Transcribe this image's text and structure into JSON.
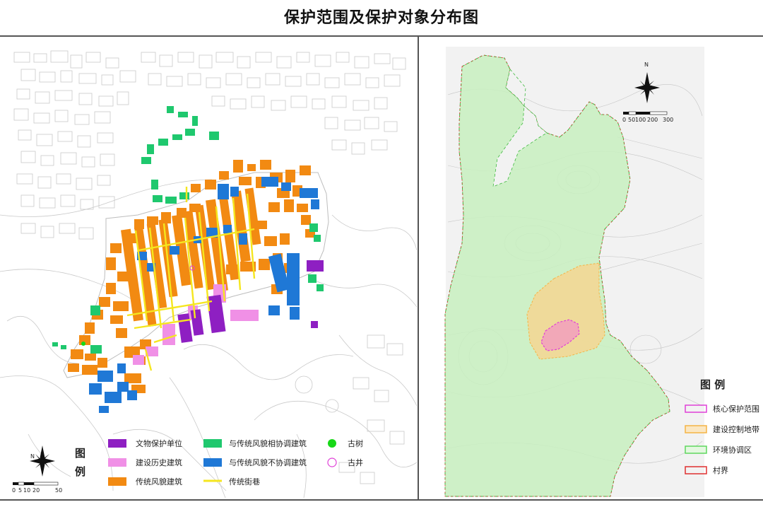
{
  "title": "保护范围及保护对象分布图",
  "left_map": {
    "legend_title_1": "图",
    "legend_title_2": "例",
    "scale_labels": [
      "0",
      "5",
      "10",
      "20",
      "50"
    ],
    "north_label": "N",
    "legend": [
      {
        "label": "文物保护单位",
        "color": "#8e1fc2"
      },
      {
        "label": "建设历史建筑",
        "color": "#f090e6"
      },
      {
        "label": "传统风貌建筑",
        "color": "#f28a12"
      },
      {
        "label": "与传统风貌相协调建筑",
        "color": "#1fc86e"
      },
      {
        "label": "与传统风貌不协调建筑",
        "color": "#1f78d6"
      },
      {
        "label": "传统街巷",
        "color": "#f5e61f"
      },
      {
        "label": "古树",
        "color": "#18d818"
      },
      {
        "label": "古井",
        "color": "#e040d8"
      }
    ]
  },
  "right_map": {
    "north_label": "N",
    "scale_labels": [
      "0",
      "50",
      "100",
      "200",
      "300"
    ],
    "legend_title": "图 例",
    "legend": [
      {
        "label": "核心保护范围",
        "color": "#e040d8"
      },
      {
        "label": "建设控制地带",
        "color": "#f5b445"
      },
      {
        "label": "环境协调区",
        "color": "#5fd85f"
      },
      {
        "label": "村界",
        "color": "#e03030"
      }
    ]
  }
}
